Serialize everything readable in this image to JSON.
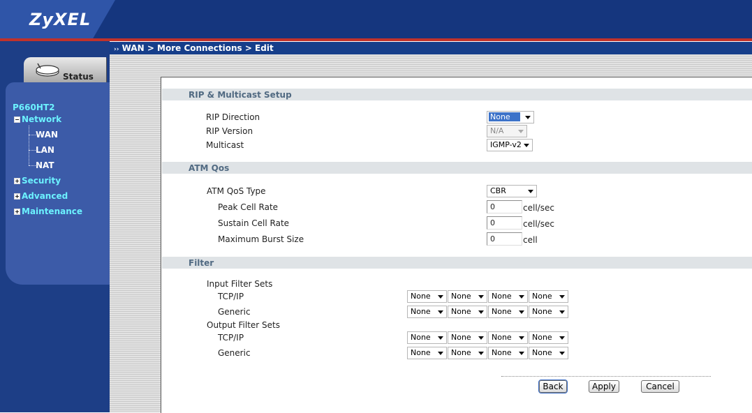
{
  "brand": {
    "logo": "ZyXEL"
  },
  "breadcrumb": "WAN > More Connections > Edit",
  "nav": {
    "status_label": "Status",
    "model": "P660HT2",
    "network": "Network",
    "wan": "WAN",
    "lan": "LAN",
    "nat": "NAT",
    "security": "Security",
    "advanced": "Advanced",
    "maintenance": "Maintenance"
  },
  "rip": {
    "title": "RIP & Multicast Setup",
    "direction_label": "RIP Direction",
    "direction_value": "None",
    "version_label": "RIP Version",
    "version_value": "N/A",
    "multicast_label": "Multicast",
    "multicast_value": "IGMP-v2"
  },
  "atm": {
    "title": "ATM Qos",
    "qos_type_label": "ATM QoS Type",
    "qos_type_value": "CBR",
    "pcr_label": "Peak Cell Rate",
    "pcr_value": "0",
    "pcr_unit": "cell/sec",
    "scr_label": "Sustain Cell Rate",
    "scr_value": "0",
    "scr_unit": "cell/sec",
    "mbs_label": "Maximum Burst Size",
    "mbs_value": "0",
    "mbs_unit": "cell"
  },
  "filter": {
    "title": "Filter",
    "input_label": "Input Filter Sets",
    "output_label": "Output Filter Sets",
    "tcpip_label": "TCP/IP",
    "generic_label": "Generic",
    "none": "None"
  },
  "buttons": {
    "back": "Back",
    "apply": "Apply",
    "cancel": "Cancel"
  },
  "colors": {
    "banner": "#15367e",
    "accent_line": "#c0322b",
    "nav_text": "#6cf2ff",
    "section_text": "#516a82"
  }
}
